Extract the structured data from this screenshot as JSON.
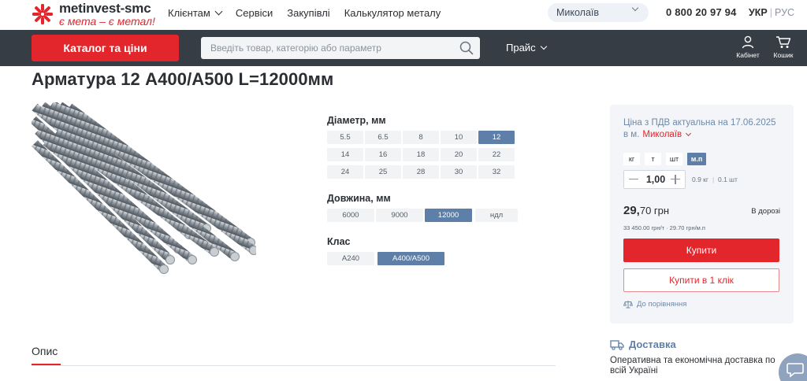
{
  "header": {
    "logo_name": "metinvest-smc",
    "logo_slogan": "є мета – є метал!",
    "nav": [
      "Клієнтам",
      "Сервіси",
      "Закупівлі",
      "Калькулятор металу"
    ],
    "city": "Миколаїв",
    "phone": "0 800 20 97 94",
    "lang_active": "УКР",
    "lang_separator": "|",
    "lang_inactive": "РУС"
  },
  "toolbar": {
    "catalog_label": "Каталог та ціни",
    "search_placeholder": "Введіть товар, категорію або параметр",
    "price_label": "Прайс",
    "cabinet_label": "Кабінет",
    "cart_label": "Кошик"
  },
  "product": {
    "title": "Арматура 12 А400/А500 L=12000мм"
  },
  "params": {
    "diameter": {
      "title": "Діаметр, мм",
      "rows": [
        [
          "5.5",
          "6.5",
          "8",
          "10",
          "12"
        ],
        [
          "14",
          "16",
          "18",
          "20",
          "22"
        ],
        [
          "24",
          "25",
          "28",
          "30",
          "32"
        ]
      ],
      "selected": "12"
    },
    "length": {
      "title": "Довжина, мм",
      "options": [
        "6000",
        "9000",
        "12000",
        "ндл"
      ],
      "selected": "12000"
    },
    "class": {
      "title": "Клас",
      "options": [
        "А240",
        "А400/А500"
      ],
      "selected": "А400/А500"
    }
  },
  "price_card": {
    "date_text": "Ціна з ПДВ актуальна на 17.06.2025",
    "city_prefix": "в м.",
    "city_name": "Миколаїв",
    "units": [
      "кг",
      "т",
      "шт",
      "м.п"
    ],
    "unit_selected": "м.п",
    "quantity": "1,00",
    "hint_kg": "0.9 кг",
    "hint_sep": "|",
    "hint_t": "0.1 шт",
    "price_int": "29,",
    "price_frac": "70 грн",
    "status": "В дорозі",
    "price_sub": "33 450.00 грн/т · 29.70 грн/м.п",
    "buy_label": "Купити",
    "buy_one_label": "Купити в 1 клік",
    "compare_label": "До порівняння"
  },
  "description": {
    "tab_label": "Опис"
  },
  "delivery": {
    "title": "Доставка",
    "text": "Оперативна та економічна доставка по всій Україні"
  },
  "colors": {
    "brand_red": "#e3262b",
    "dark_bar": "#363d45",
    "accent_blue": "#5d7fa8"
  }
}
